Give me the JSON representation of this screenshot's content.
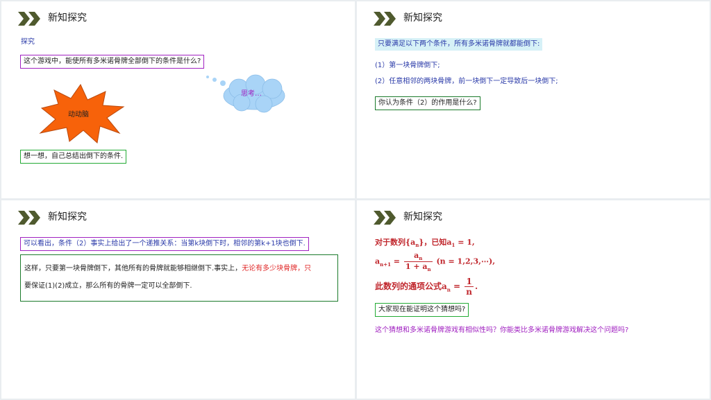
{
  "slides": [
    {
      "header": "新知探究",
      "section_label": "探究",
      "question": "这个游戏中，能使所有多米诺骨牌全部倒下的条件是什么?",
      "burst_label": "动动脑",
      "cloud_label": "思考…",
      "prompt": "想一想，自己总结出倒下的条件."
    },
    {
      "header": "新知探究",
      "intro": "只要满足以下两个条件，所有多米诺骨牌就都能倒下:",
      "cond1": "(1）第一块骨牌倒下;",
      "cond2": "(2）任意相邻的两块骨牌，前一块倒下一定导致后一块倒下;",
      "question": "你认为条件（2）的作用是什么?"
    },
    {
      "header": "新知探究",
      "summary": "可以看出，条件（2）事实上给出了一个递推关系：当第k块倒下时，相邻的第k+1块也倒下.",
      "para_a": "这样，只要第一块骨牌倒下，其他所有的骨牌就能够相继倒下.事实上，",
      "para_red": "无论有多少块骨牌，只",
      "para_b": "要保证(1)(2)成立，那么所有的骨牌一定可以全部倒下."
    },
    {
      "header": "新知探究",
      "f1_text": "对于数列{a",
      "f1_sub": "n",
      "f1_mid": "}，已知a",
      "f1_sub2": "1",
      "f1_end": " = 1,",
      "f2_lhs": "a",
      "f2_lhs_sub": "n+1",
      "f2_eq": " = ",
      "f2_num": "a",
      "f2_num_sub": "n",
      "f2_den": "1 + a",
      "f2_den_sub": "n",
      "f2_tail": "(n = 1,2,3,⋯),",
      "f3_text": "此数列的通项公式a",
      "f3_sub": "n",
      "f3_eq": " = ",
      "f3_num": "1",
      "f3_den": "n",
      "f3_end": ".",
      "question": "大家现在能证明这个猜想吗?",
      "followup": "这个猜想和多米诺骨牌游戏有相似性吗？你能类比多米诺骨牌游戏解决这个问题吗?"
    }
  ],
  "colors": {
    "chevron": "#4f5a2e",
    "blue_text": "#2a3aa8",
    "red_text": "#e02828",
    "formula_red": "#c0262c",
    "purple_text": "#a020c0",
    "burst_fill": "#f7620a",
    "cloud_fill": "#a9d4f7",
    "highlight_bg": "#d6f1f7"
  },
  "icons": [
    "double-chevron-icon",
    "burst-shape",
    "thought-cloud-shape"
  ]
}
